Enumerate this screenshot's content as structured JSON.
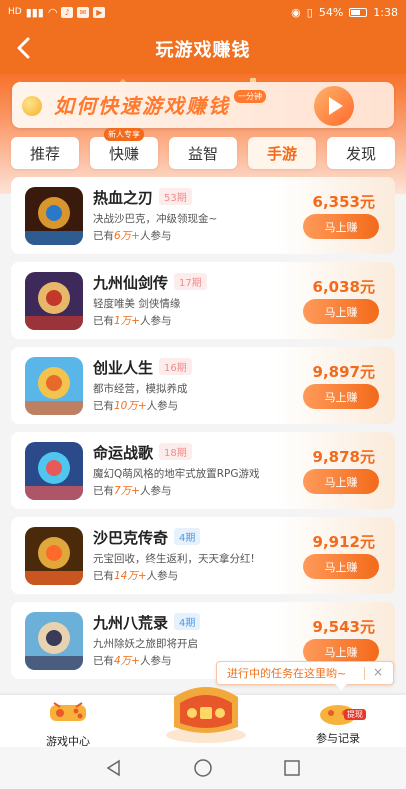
{
  "status_bar": {
    "left_label": "HD",
    "battery": "54%",
    "time": "1:38"
  },
  "header": {
    "title": "玩游戏赚钱"
  },
  "banner": {
    "text": "如何快速游戏赚钱",
    "badge": "一分钟"
  },
  "tabs": [
    {
      "label": "推荐",
      "badge": ""
    },
    {
      "label": "快赚",
      "badge": "新人专享"
    },
    {
      "label": "益智",
      "badge": ""
    },
    {
      "label": "手游",
      "badge": ""
    },
    {
      "label": "发现",
      "badge": ""
    }
  ],
  "active_tab": "手游",
  "games": [
    {
      "name": "热血之刃",
      "period": "53期",
      "desc": "决战沙巴克，冲级领现金~",
      "joined_prefix": "已有",
      "joined_count": "6万+",
      "joined_suffix": "人参与",
      "reward": "6,353元",
      "button": "马上赚",
      "period_color": "#f28c8c",
      "period_bg": "#fdecec"
    },
    {
      "name": "九州仙剑传",
      "period": "17期",
      "desc": "轻度唯美 剑侠情缘",
      "joined_prefix": "已有",
      "joined_count": "1万+",
      "joined_suffix": "人参与",
      "reward": "6,038元",
      "button": "马上赚",
      "period_color": "#f28c8c",
      "period_bg": "#fdecec"
    },
    {
      "name": "创业人生",
      "period": "16期",
      "desc": "都市经营，模拟养成",
      "joined_prefix": "已有",
      "joined_count": "10万+",
      "joined_suffix": "人参与",
      "reward": "9,897元",
      "button": "马上赚",
      "period_color": "#f28c8c",
      "period_bg": "#fdecec"
    },
    {
      "name": "命运战歌",
      "period": "18期",
      "desc": "魔幻Q萌风格的地牢式放置RPG游戏",
      "joined_prefix": "已有",
      "joined_count": "7万+",
      "joined_suffix": "人参与",
      "reward": "9,878元",
      "button": "马上赚",
      "period_color": "#f28c8c",
      "period_bg": "#fdecec"
    },
    {
      "name": "沙巴克传奇",
      "period": "4期",
      "desc": "元宝回收，终生返利，天天拿分红!",
      "joined_prefix": "已有",
      "joined_count": "14万+",
      "joined_suffix": "人参与",
      "reward": "9,912元",
      "button": "马上赚",
      "period_color": "#4a9be8",
      "period_bg": "#e6f1fc"
    },
    {
      "name": "九州八荒录",
      "period": "4期",
      "desc": "九州除妖之旅即将开启",
      "joined_prefix": "已有",
      "joined_count": "4万+",
      "joined_suffix": "人参与",
      "reward": "9,543元",
      "button": "马上赚",
      "period_color": "#4a9be8",
      "period_bg": "#e6f1fc"
    }
  ],
  "tooltip": {
    "text": "进行中的任务在这里哟~",
    "close": "×"
  },
  "bottom_nav": {
    "left_label": "游戏中心",
    "center_label": "",
    "right_label": "参与记录",
    "right_badge": "提现"
  },
  "colors": {
    "brand": "#f0701f",
    "accent": "#f36a1a"
  }
}
